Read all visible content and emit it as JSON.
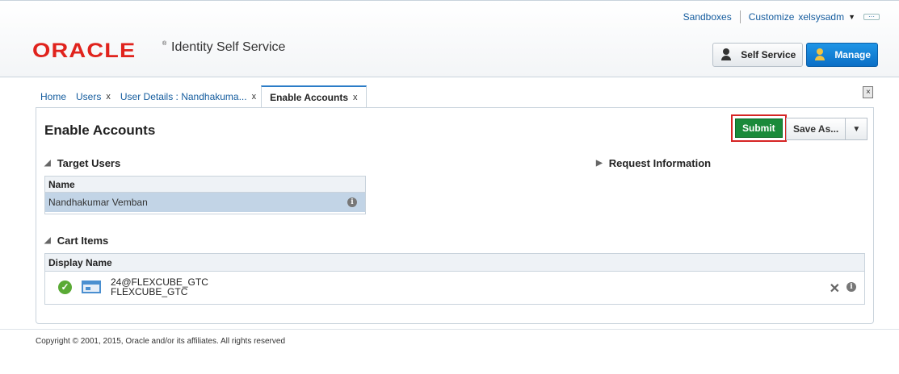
{
  "header": {
    "logo": "ORACLE",
    "app_title": "Identity Self Service",
    "links": {
      "sandboxes": "Sandboxes",
      "customize": "Customize"
    },
    "user": "xelsysadm",
    "self_service": "Self Service",
    "manage": "Manage"
  },
  "tabs": [
    {
      "label": "Home",
      "closable": false
    },
    {
      "label": "Users",
      "closable": true
    },
    {
      "label": "User Details : Nandhakuma...",
      "closable": true
    },
    {
      "label": "Enable Accounts",
      "closable": true
    }
  ],
  "page": {
    "title": "Enable Accounts",
    "submit": "Submit",
    "save_as": "Save As..."
  },
  "target_users": {
    "heading": "Target Users",
    "column": "Name",
    "rows": [
      "Nandhakumar Vemban"
    ]
  },
  "request_info": {
    "heading": "Request Information"
  },
  "cart": {
    "heading": "Cart Items",
    "column": "Display Name",
    "items": [
      {
        "line1": "24@FLEXCUBE_GTC",
        "line2": "FLEXCUBE_GTC"
      }
    ]
  },
  "footer": {
    "copyright": "Copyright © 2001, 2015, Oracle and/or its affiliates. All rights reserved"
  },
  "colors": {
    "submit": "#1a8a3a",
    "highlight": "#d62424",
    "manage": "#0b6fc6",
    "brand": "#e0231d"
  }
}
